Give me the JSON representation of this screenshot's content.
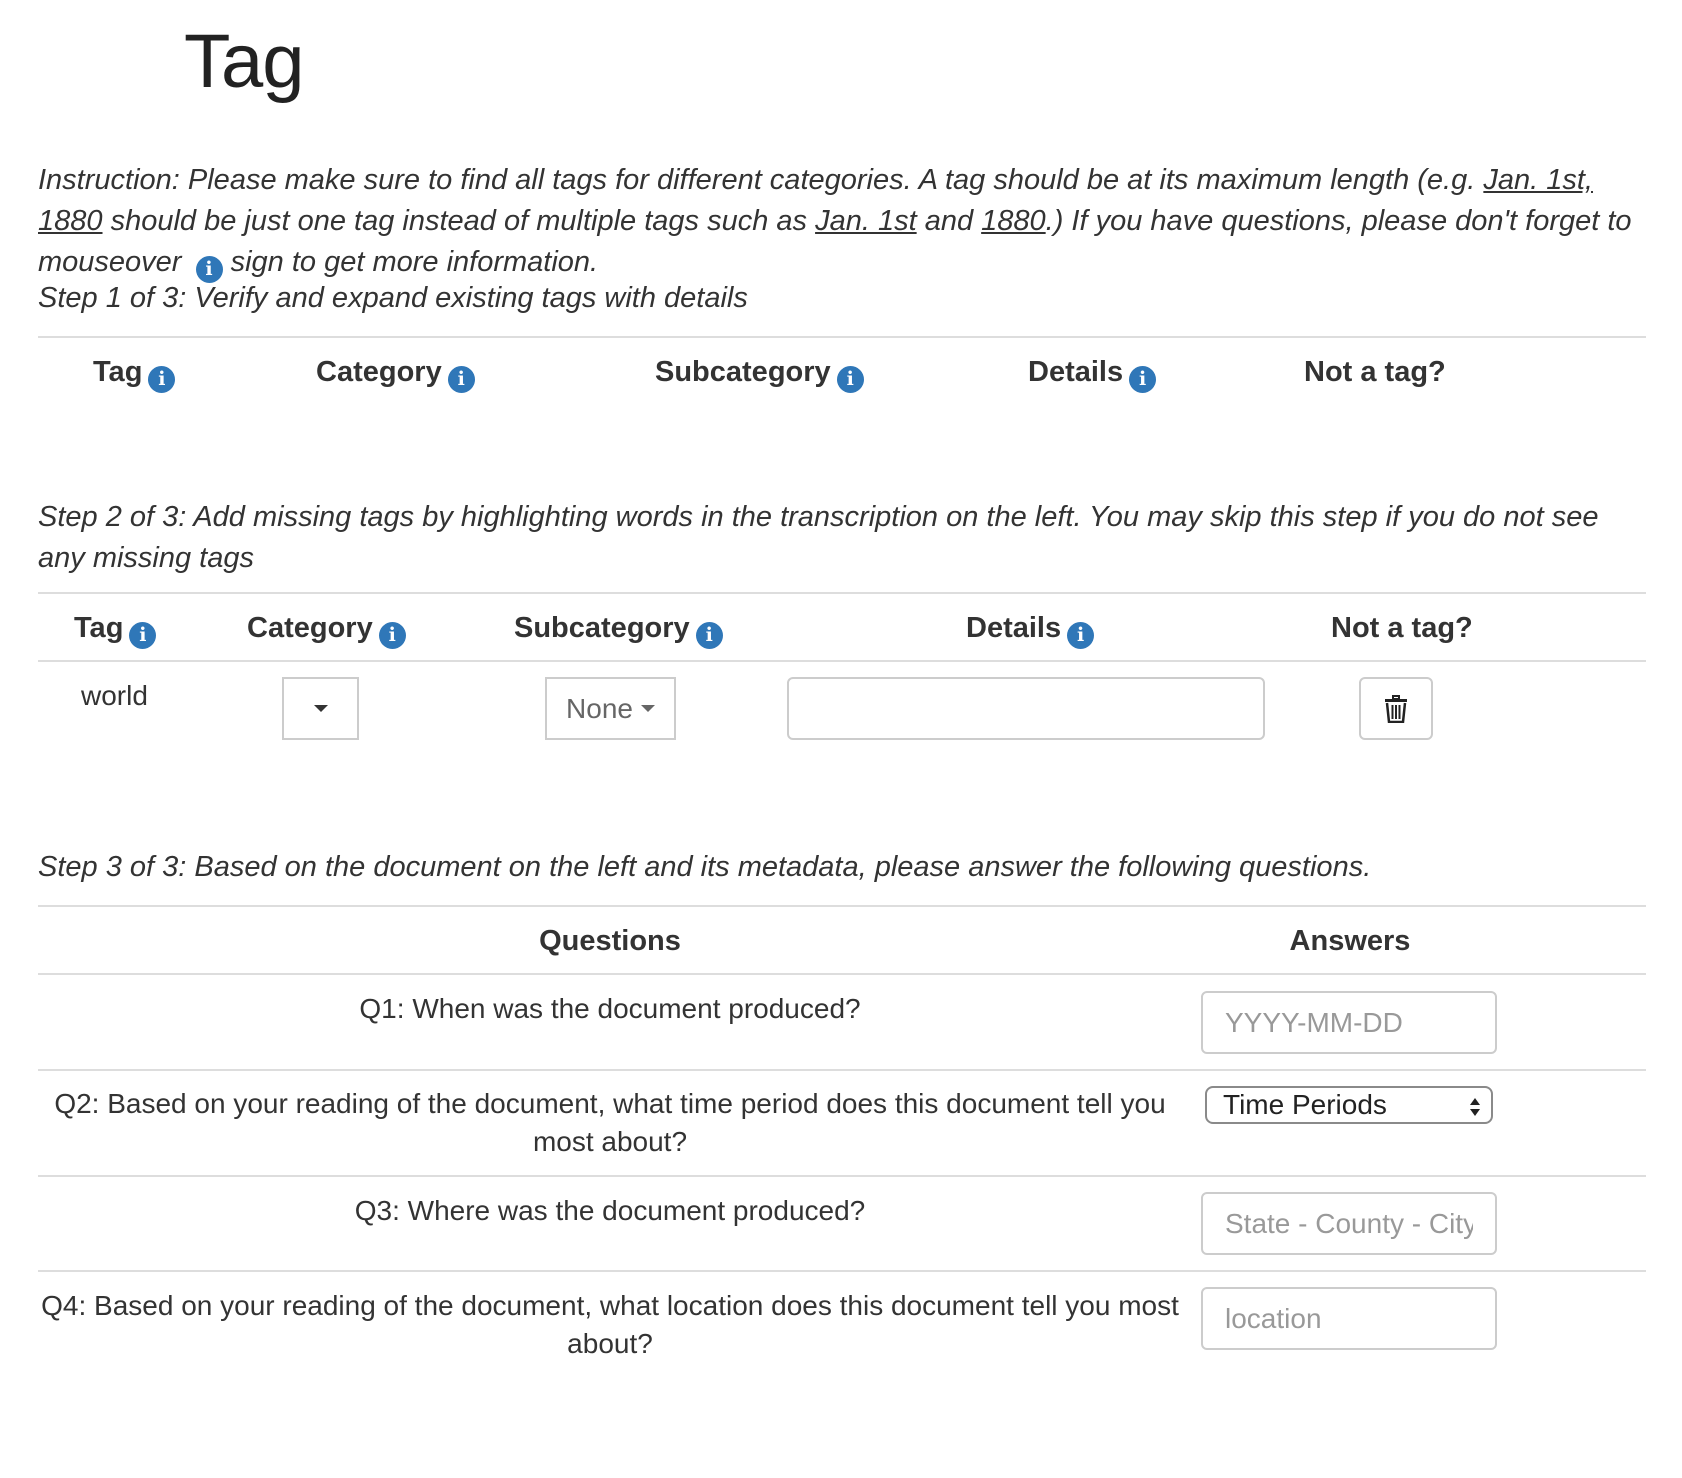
{
  "page": {
    "title": "Tag",
    "instruction": {
      "p1": "Instruction: Please make sure to find all tags for different categories. A tag should be at its maximum length (e.g. ",
      "ex1": "Jan. 1st, 1880",
      "p2": " should be just one tag instead of multiple tags such as ",
      "ex2": "Jan. 1st",
      "p3": " and ",
      "ex3": "1880",
      "p4": ".) If you have questions, please don't forget to mouseover ",
      "p5": " sign to get more information."
    }
  },
  "step1": {
    "title": "Step 1 of 3: Verify and expand existing tags with details",
    "columns": {
      "tag": "Tag",
      "category": "Category",
      "subcategory": "Subcategory",
      "details": "Details",
      "not_tag": "Not a tag?"
    }
  },
  "step2": {
    "title": "Step 2 of 3: Add missing tags by highlighting words in the transcription on the left. You may skip this step if you do not see any missing tags",
    "columns": {
      "tag": "Tag",
      "category": "Category",
      "subcategory": "Subcategory",
      "details": "Details",
      "not_tag": "Not a tag?"
    },
    "row": {
      "tag": "world",
      "category": "",
      "subcategory": "None",
      "details": ""
    }
  },
  "step3": {
    "title": "Step 3 of 3: Based on the document on the left and its metadata, please answer the following questions.",
    "columns": {
      "questions": "Questions",
      "answers": "Answers"
    },
    "questions": [
      {
        "text": "Q1: When was the document produced?",
        "placeholder": "YYYY-MM-DD"
      },
      {
        "text": "Q2: Based on your reading of the document, what time period does this document tell you most about?",
        "select_value": "Time Periods"
      },
      {
        "text": "Q3: Where was the document produced?",
        "placeholder": "State - County - City/"
      },
      {
        "text": "Q4: Based on your reading of the document, what location does this document tell you most about?",
        "placeholder": "location"
      }
    ]
  },
  "icons": {
    "info": "info-circle-icon",
    "trash": "trash-icon",
    "caret": "caret-down-icon"
  },
  "colors": {
    "info_blue": "#2f77b8",
    "text": "#333333",
    "border": "#cccccc",
    "divider": "#dddddd"
  }
}
